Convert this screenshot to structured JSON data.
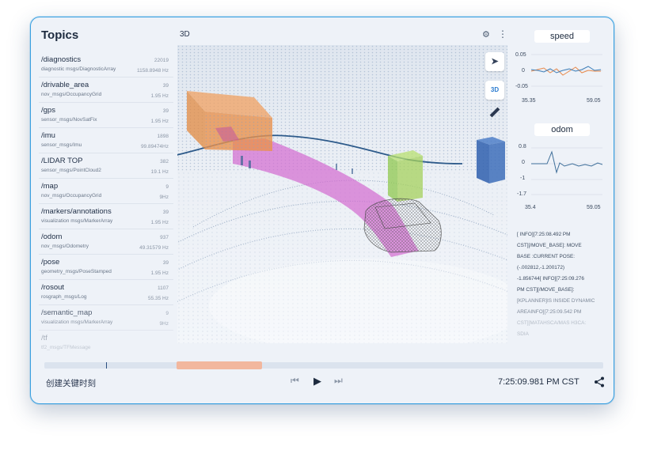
{
  "topics_panel": {
    "title": "Topics",
    "items": [
      {
        "name": "/diagnostics",
        "type": "diagnostic msgs/DiagnosticArray",
        "count": "22019",
        "rate": "1158.8948 Hz"
      },
      {
        "name": "/drivable_area",
        "type": "nov_msgs/OccupancyGrid",
        "count": "39",
        "rate": "1.95 Hz"
      },
      {
        "name": "/gps",
        "type": "sensor_msgs/NovSatFix",
        "count": "39",
        "rate": "1.95 Hz"
      },
      {
        "name": "/imu",
        "type": "sensor_msgs/Imu",
        "count": "1898",
        "rate": "99.89474Hz"
      },
      {
        "name": "/LIDAR TOP",
        "type": "sensor_msgs/PointCloud2",
        "count": "382",
        "rate": "19.1 Hz"
      },
      {
        "name": "/map",
        "type": "nov_msgs/OccupancyGrid",
        "count": "9",
        "rate": "9Hz"
      },
      {
        "name": "/markers/annotations",
        "type": "visualization msgs/MarkerArray",
        "count": "39",
        "rate": "1.95 Hz"
      },
      {
        "name": "/odom",
        "type": "nov_msgs/Odometry",
        "count": "937",
        "rate": "49.31579 Hz"
      },
      {
        "name": "/pose",
        "type": "geometry_msgs/PoseStamped",
        "count": "39",
        "rate": "1.95 Hz"
      },
      {
        "name": "/rosout",
        "type": "rosgraph_msgs/Log",
        "count": "1107",
        "rate": "55.35 Hz"
      },
      {
        "name": "/semantic_map",
        "type": "visualization msgs/MarkerArray",
        "count": "9",
        "rate": "9Hz"
      },
      {
        "name": "/tf",
        "type": "tf2_msgs/TFMessage",
        "count": "",
        "rate": ""
      }
    ]
  },
  "viewport": {
    "label": "3D",
    "mode_button": "3D",
    "icons": [
      "gear-icon",
      "kebab-menu-icon",
      "cursor-icon",
      "ruler-icon"
    ]
  },
  "charts": {
    "speed": {
      "title": "speed",
      "y_ticks": [
        "0.05",
        "0",
        "-0.05"
      ],
      "x_start": "35.35",
      "x_end": "59.05"
    },
    "odom": {
      "title": "odom",
      "y_ticks": [
        "0.8",
        "0",
        "-1",
        "-1.7"
      ],
      "x_start": "35.4",
      "x_end": "59.05"
    },
    "colors": {
      "series_a": "#e8894a",
      "series_b": "#3f7fb8",
      "odom": "#3f6f9a"
    }
  },
  "log": {
    "lines": [
      "[ INFO][7:25:08.492 PM",
      "CST][/MOVE_BASE]: MOVE",
      "BASE :CURRENT POSE:",
      "(-.002812,-1.200172)",
      "-1.856744[ INFO][7:25:09.276",
      "PM CST][/MOVE_BASE]:",
      "[KPLANNER]IS INSIDE DYNAMIC",
      "AREAINFO][7:25:09.542 PM",
      "CST][MATAHSCA/MAS H3CA:",
      "SDIA"
    ]
  },
  "playback": {
    "bookmark_label": "创建关键时刻",
    "timestamp": "7:25:09.981 PM CST",
    "progress": 0.11,
    "range_start": 0.237,
    "range_end": 0.389
  }
}
